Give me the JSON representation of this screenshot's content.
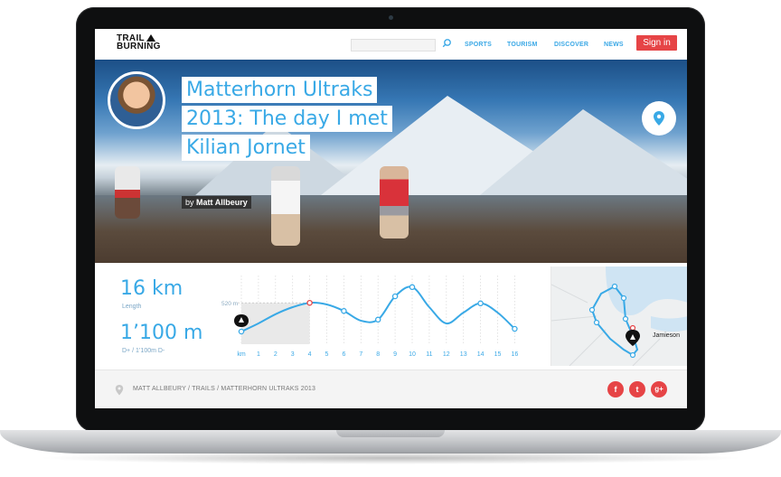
{
  "header": {
    "logo_line1": "TRAIL",
    "logo_line2": "BURNING",
    "nav": [
      "SPORTS",
      "TOURISM",
      "DISCOVER",
      "NEWS"
    ],
    "signin": "Sign in",
    "accent": "#39a9e6",
    "signin_color": "#e64446"
  },
  "hero": {
    "title_lines": [
      "Matterhorn Ultraks",
      "2013: The day I met",
      "Kilian Jornet"
    ],
    "by_prefix": "by",
    "author": "Matt Allbeury"
  },
  "stats": {
    "distance": "16 km",
    "distance_label": "Length",
    "elevation": "1’100 m",
    "elevation_label": "D+ / 1’100m D-"
  },
  "chart_data": {
    "type": "line",
    "x_ticks": [
      "km",
      "1",
      "2",
      "3",
      "4",
      "5",
      "6",
      "7",
      "8",
      "9",
      "10",
      "11",
      "12",
      "13",
      "14",
      "15",
      "16"
    ],
    "annotation": "520 m",
    "x": [
      0,
      1,
      2,
      3,
      4,
      5,
      6,
      7,
      8,
      9,
      10,
      11,
      12,
      13,
      14,
      15,
      16
    ],
    "y": [
      0.1,
      0.25,
      0.42,
      0.55,
      0.63,
      0.6,
      0.48,
      0.3,
      0.32,
      0.75,
      0.92,
      0.55,
      0.25,
      0.45,
      0.62,
      0.45,
      0.15
    ],
    "line_color": "#39a9e6",
    "highlight_color": "#e64446"
  },
  "map": {
    "place": "Jamieson"
  },
  "footer": {
    "breadcrumb": [
      "MATT ALLBEURY",
      "TRAILS",
      "MATTERHORN ULTRAKS 2013"
    ],
    "separator": "/",
    "social": [
      "f",
      "t",
      "g+"
    ]
  }
}
